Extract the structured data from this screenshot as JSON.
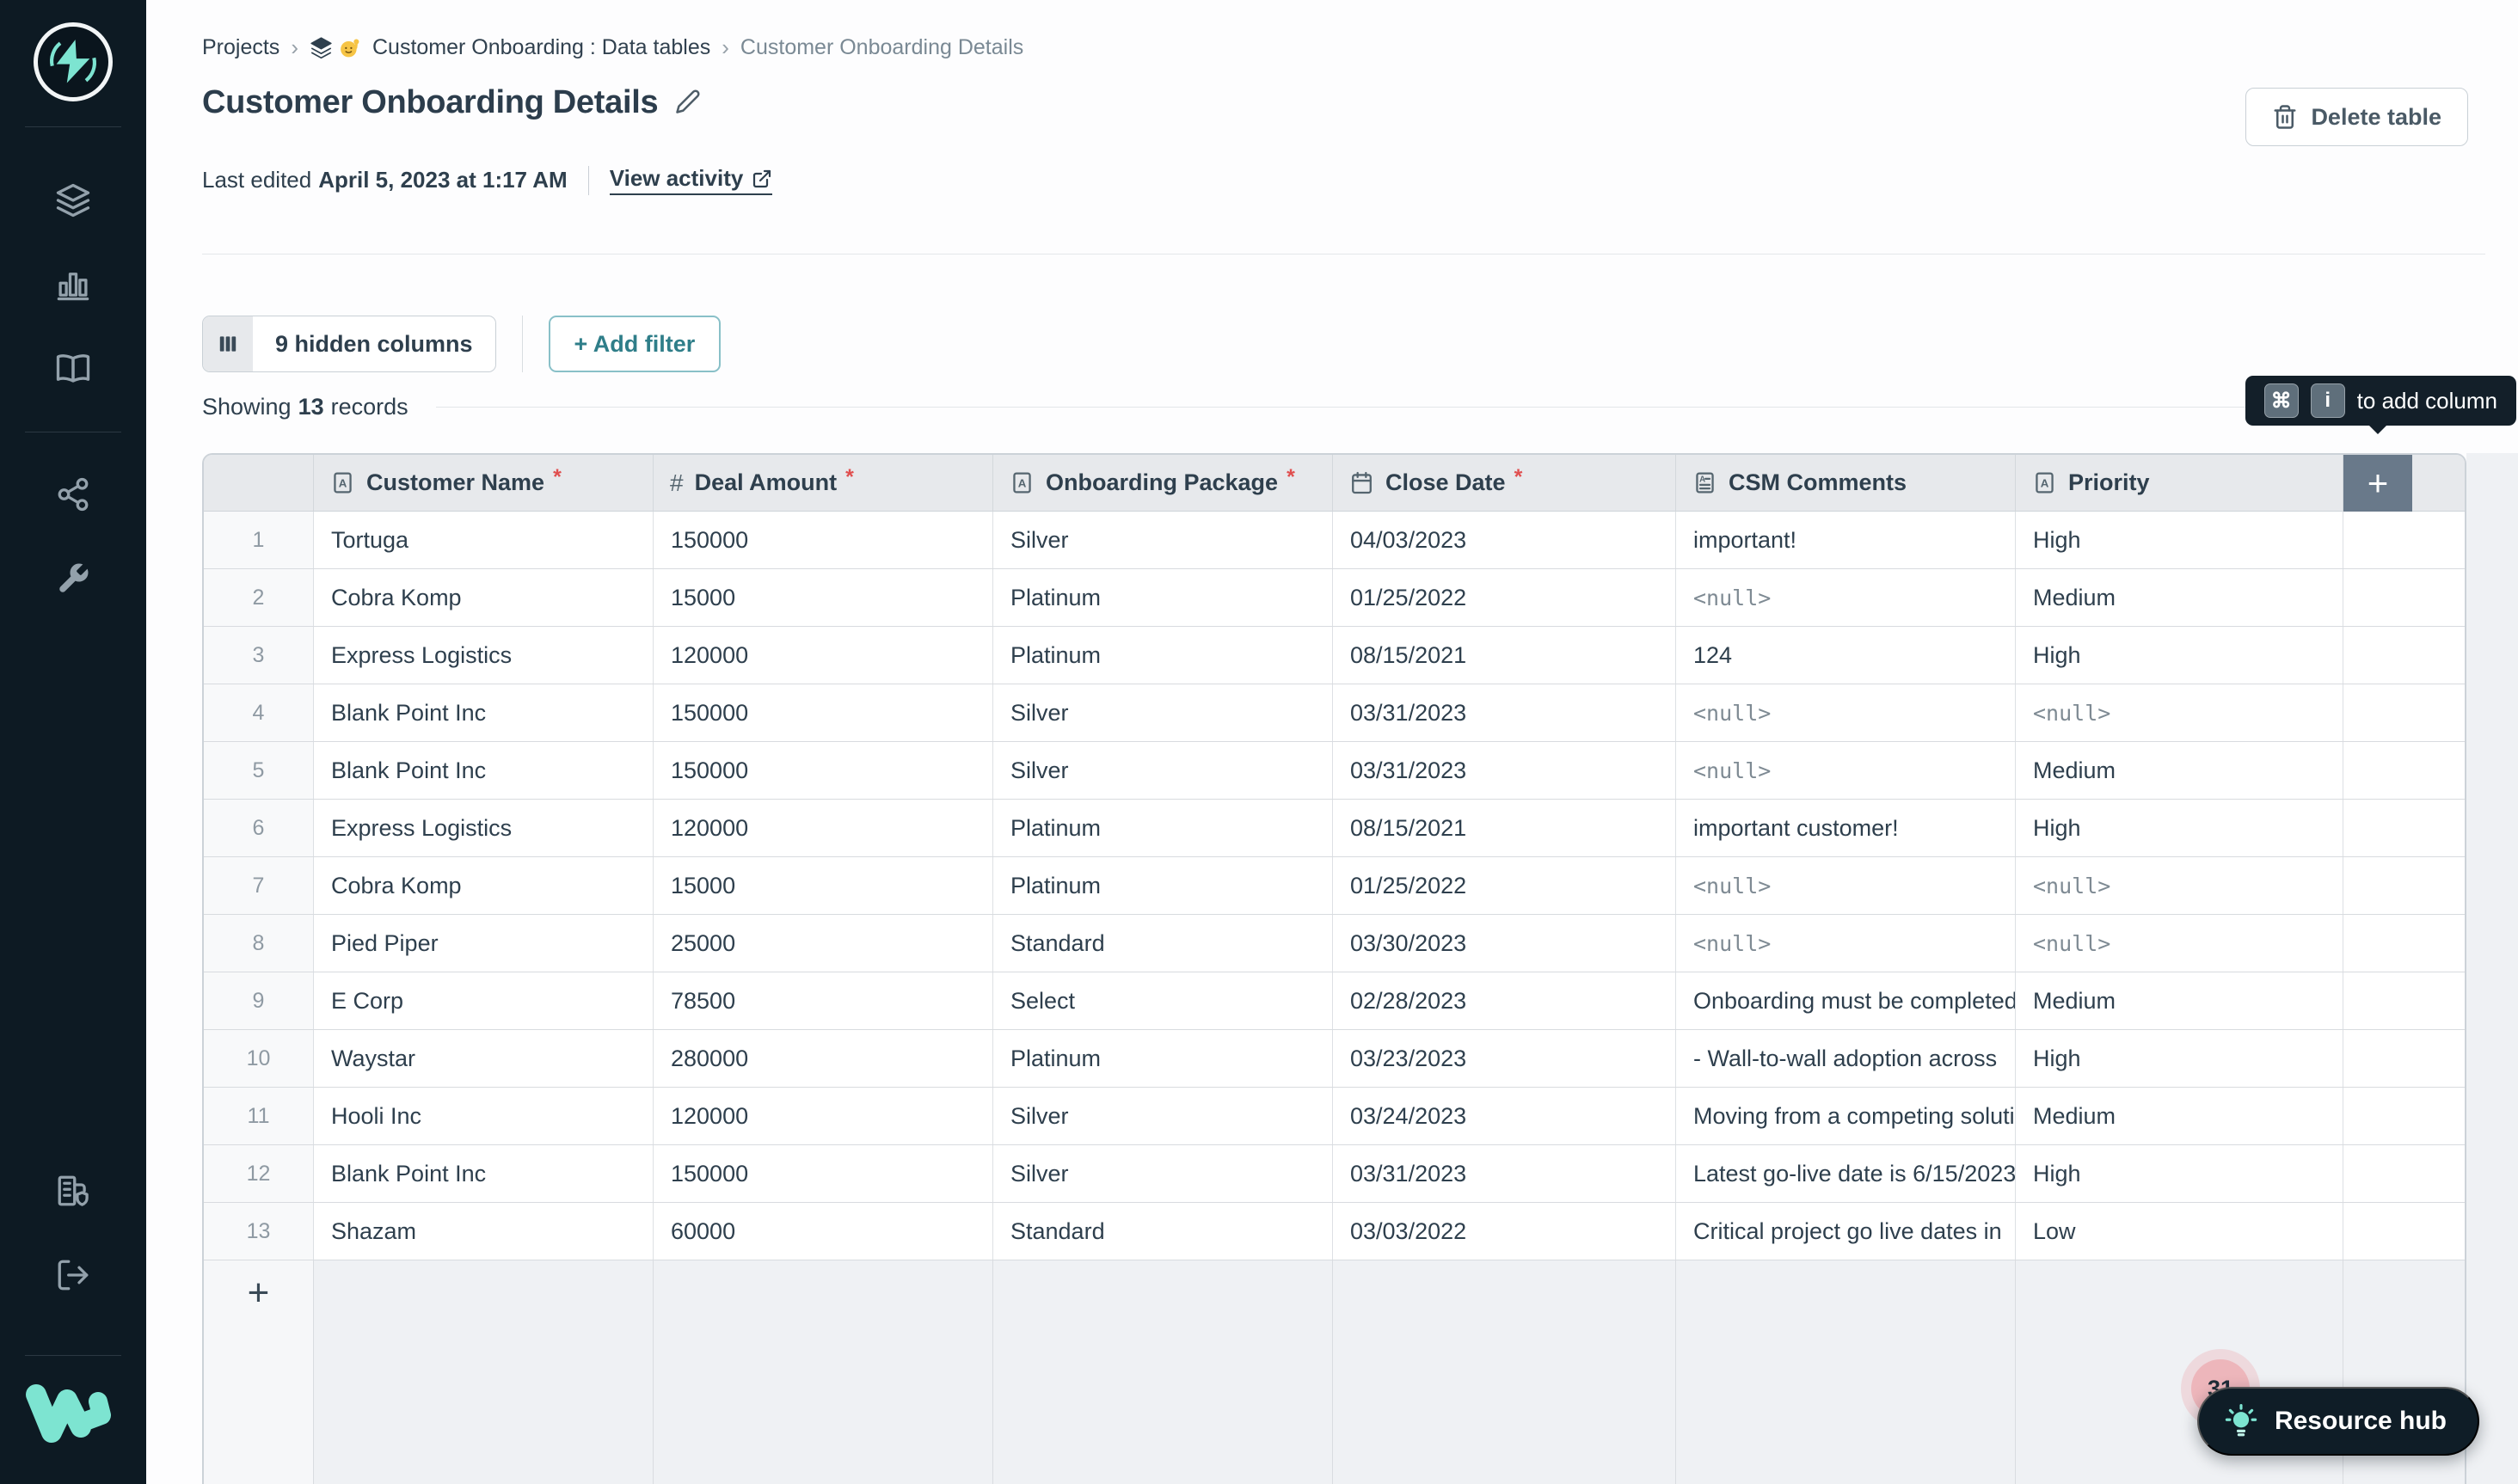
{
  "sidebar": {
    "main_icons": [
      "layers",
      "bar-chart",
      "book"
    ],
    "tool_icons": [
      "share",
      "wrench"
    ],
    "bottom_icons": [
      "organization",
      "logout"
    ]
  },
  "breadcrumb": {
    "projects": "Projects",
    "section": "Customer Onboarding : Data tables",
    "current": "Customer Onboarding Details",
    "separator": "›"
  },
  "header": {
    "title": "Customer Onboarding Details",
    "last_edited_label": "Last edited",
    "last_edited_value": "April 5, 2023 at 1:17 AM",
    "view_activity_label": "View activity",
    "delete_table_label": "Delete table"
  },
  "toolbar": {
    "hidden_columns_label": "9 hidden columns",
    "add_filter_label": "+ Add filter",
    "showing_prefix": "Showing",
    "record_count": "13",
    "showing_suffix": "records"
  },
  "add_column_tooltip": {
    "key_1": "⌘",
    "key_2": "i",
    "text": "to add column"
  },
  "table": {
    "columns": [
      {
        "label": "Customer Name",
        "type": "text",
        "required": true
      },
      {
        "label": "Deal Amount",
        "type": "number",
        "required": true
      },
      {
        "label": "Onboarding Package",
        "type": "text",
        "required": true
      },
      {
        "label": "Close Date",
        "type": "date",
        "required": true
      },
      {
        "label": "CSM Comments",
        "type": "longtext",
        "required": false
      },
      {
        "label": "Priority",
        "type": "text",
        "required": false
      }
    ],
    "null_text": "<null>",
    "rows": [
      {
        "num": "1",
        "cells": [
          "Tortuga",
          "150000",
          "Silver",
          "04/03/2023",
          "important!",
          "High"
        ]
      },
      {
        "num": "2",
        "cells": [
          "Cobra Komp",
          "15000",
          "Platinum",
          "01/25/2022",
          "<null>",
          "Medium"
        ]
      },
      {
        "num": "3",
        "cells": [
          "Express Logistics",
          "120000",
          "Platinum",
          "08/15/2021",
          "124",
          "High"
        ]
      },
      {
        "num": "4",
        "cells": [
          "Blank Point Inc",
          "150000",
          "Silver",
          "03/31/2023",
          "<null>",
          "<null>"
        ]
      },
      {
        "num": "5",
        "cells": [
          "Blank Point Inc",
          "150000",
          "Silver",
          "03/31/2023",
          "<null>",
          "Medium"
        ]
      },
      {
        "num": "6",
        "cells": [
          "Express Logistics",
          "120000",
          "Platinum",
          "08/15/2021",
          "important customer!",
          "High"
        ]
      },
      {
        "num": "7",
        "cells": [
          "Cobra Komp",
          "15000",
          "Platinum",
          "01/25/2022",
          "<null>",
          "<null>"
        ]
      },
      {
        "num": "8",
        "cells": [
          "Pied Piper",
          "25000",
          "Standard",
          "03/30/2023",
          "<null>",
          "<null>"
        ]
      },
      {
        "num": "9",
        "cells": [
          "E Corp",
          "78500",
          "Select",
          "02/28/2023",
          "Onboarding must be completed",
          "Medium"
        ]
      },
      {
        "num": "10",
        "cells": [
          "Waystar",
          "280000",
          "Platinum",
          "03/23/2023",
          "- Wall-to-wall adoption across",
          "High"
        ]
      },
      {
        "num": "11",
        "cells": [
          "Hooli Inc",
          "120000",
          "Silver",
          "03/24/2023",
          "Moving from a competing solution",
          "Medium"
        ]
      },
      {
        "num": "12",
        "cells": [
          "Blank Point Inc",
          "150000",
          "Silver",
          "03/31/2023",
          "Latest go-live date is 6/15/2023",
          "High"
        ]
      },
      {
        "num": "13",
        "cells": [
          "Shazam",
          "60000",
          "Standard",
          "03/03/2022",
          "Critical project go live dates in",
          "Low"
        ]
      }
    ]
  },
  "footer": {
    "notification_count": "31",
    "resource_hub_label": "Resource hub"
  },
  "colors": {
    "accent_teal": "#2f7e89",
    "logo_teal": "#7de4d1",
    "required_red": "#e04f4f",
    "sidebar_bg": "#0d1a23",
    "tooltip_bg": "#131f29",
    "badge_pink": "#edb6bb",
    "plus_header": "#69798a"
  }
}
